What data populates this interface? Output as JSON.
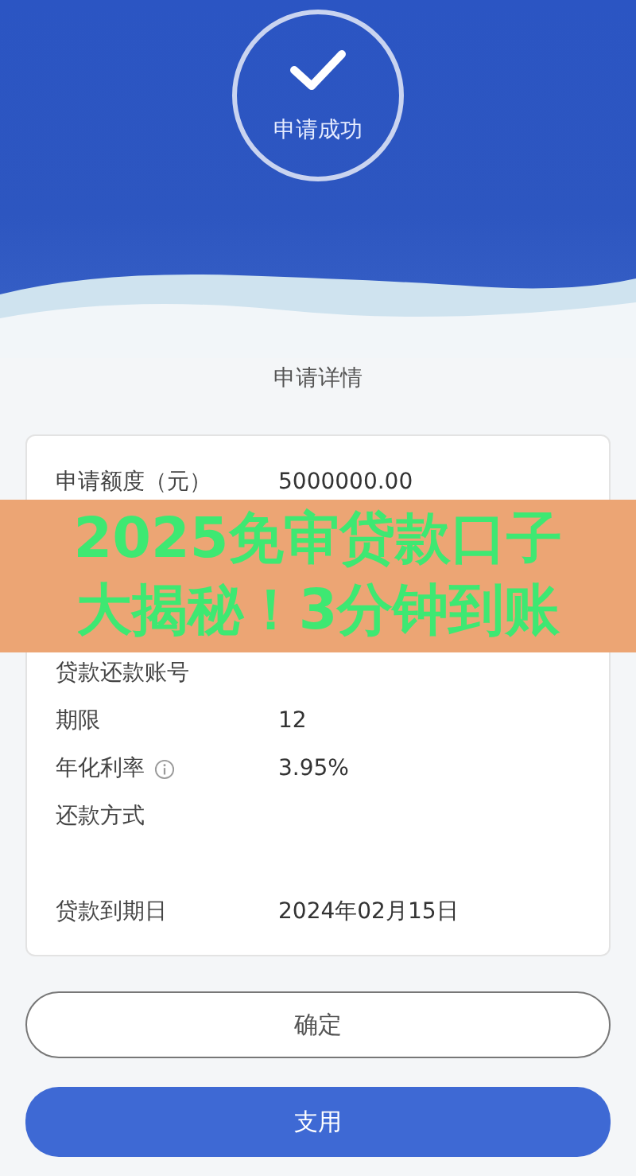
{
  "status": {
    "title": "申请成功"
  },
  "details_title": "申请详情",
  "details": [
    {
      "kind": "row",
      "label": "申请额度（元）",
      "value": "5000000.00"
    },
    {
      "kind": "hidden"
    },
    {
      "kind": "hidden"
    },
    {
      "kind": "hidden"
    },
    {
      "kind": "row",
      "label": "贷款还款账号"
    },
    {
      "kind": "row",
      "label": "期限",
      "value": "12"
    },
    {
      "kind": "info",
      "label": "年化利率",
      "value": "3.95%"
    },
    {
      "kind": "row",
      "label": "还款方式"
    },
    {
      "kind": "hidden"
    },
    {
      "kind": "row",
      "label": "贷款到期日",
      "value": "2024年02月15日"
    }
  ],
  "buttons": [
    {
      "label": "确定",
      "kind": "outline"
    },
    {
      "label": "支用",
      "kind": "primary"
    }
  ],
  "banner": {
    "lines": [
      "2025免审贷款口子",
      "大揭秘！3分钟到账"
    ]
  }
}
